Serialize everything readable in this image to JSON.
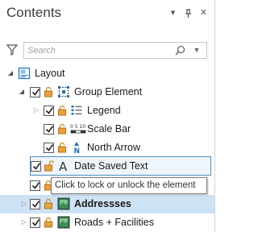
{
  "pane": {
    "title": "Contents",
    "buttons": {
      "menu": "▾",
      "pin": "⊥",
      "close": "✕"
    }
  },
  "search": {
    "placeholder": "Search"
  },
  "tree": {
    "layout": {
      "label": "Layout",
      "expanded": true
    },
    "group_element": {
      "label": "Group Element",
      "checked": true,
      "expanded": true
    },
    "legend": {
      "label": "Legend",
      "checked": true,
      "expanded": false
    },
    "scale_bar": {
      "label": "Scale Bar",
      "checked": true,
      "icon_text": "0 5 10"
    },
    "north_arrow": {
      "label": "North Arrow",
      "checked": true,
      "icon_text": "N"
    },
    "date_saved_text": {
      "label": "Date Saved Text",
      "checked": true,
      "icon_text": "A"
    },
    "hidden_item": {
      "label": "",
      "checked": true
    },
    "addresses": {
      "label": "Addressses",
      "checked": true,
      "expanded": false
    },
    "roads": {
      "label": "Roads + Facilities",
      "checked": true,
      "expanded": false
    }
  },
  "tooltip": {
    "text": "Click to lock or unlock the element"
  },
  "colors": {
    "selection_border": "#4a90c8",
    "highlight": "#cde3f5",
    "lock": "#d08a1e",
    "icon_blue": "#1f6fb5"
  }
}
